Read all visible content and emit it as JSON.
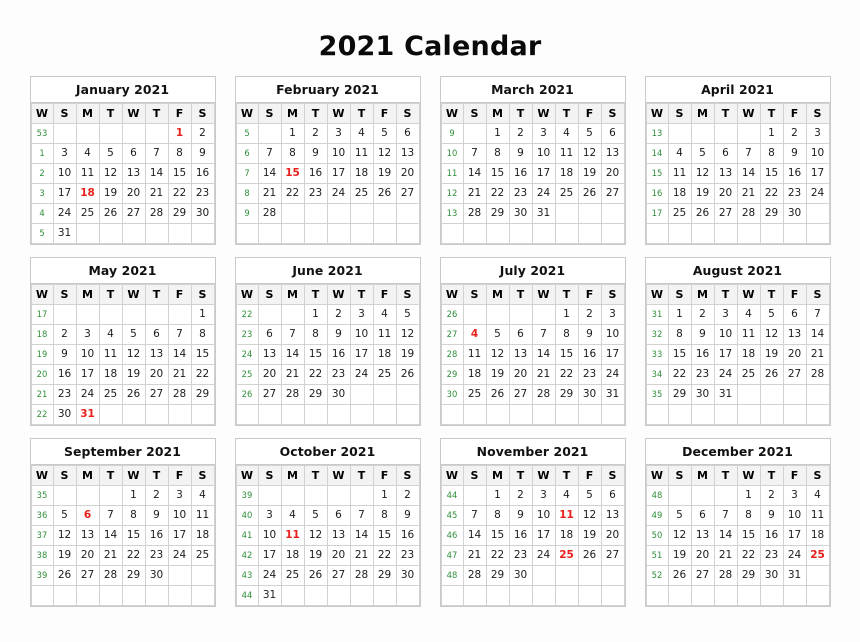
{
  "page": {
    "title": "2021 Calendar",
    "year": "2021"
  },
  "colors": {
    "week_number": "#2f8f3a",
    "holiday": "#e8201c",
    "text": "#1c1c1c",
    "header_bg": "#f3f3f3",
    "border": "#d2d2d2",
    "card_border": "#c9c9c9",
    "page_bg": "#fdfdfd"
  },
  "weekday_headers": [
    "W",
    "S",
    "M",
    "T",
    "W",
    "T",
    "F",
    "S"
  ],
  "months": [
    {
      "name": "January 2021",
      "weeks": [
        {
          "wk": "53",
          "days": [
            "",
            "",
            "",
            "",
            "",
            "1",
            "2"
          ],
          "holidays": [
            "1"
          ]
        },
        {
          "wk": "1",
          "days": [
            "3",
            "4",
            "5",
            "6",
            "7",
            "8",
            "9"
          ],
          "holidays": []
        },
        {
          "wk": "2",
          "days": [
            "10",
            "11",
            "12",
            "13",
            "14",
            "15",
            "16"
          ],
          "holidays": []
        },
        {
          "wk": "3",
          "days": [
            "17",
            "18",
            "19",
            "20",
            "21",
            "22",
            "23"
          ],
          "holidays": [
            "18"
          ]
        },
        {
          "wk": "4",
          "days": [
            "24",
            "25",
            "26",
            "27",
            "28",
            "29",
            "30"
          ],
          "holidays": []
        },
        {
          "wk": "5",
          "days": [
            "31",
            "",
            "",
            "",
            "",
            "",
            ""
          ],
          "holidays": []
        }
      ]
    },
    {
      "name": "February 2021",
      "weeks": [
        {
          "wk": "5",
          "days": [
            "",
            "1",
            "2",
            "3",
            "4",
            "5",
            "6"
          ],
          "holidays": []
        },
        {
          "wk": "6",
          "days": [
            "7",
            "8",
            "9",
            "10",
            "11",
            "12",
            "13"
          ],
          "holidays": []
        },
        {
          "wk": "7",
          "days": [
            "14",
            "15",
            "16",
            "17",
            "18",
            "19",
            "20"
          ],
          "holidays": [
            "15"
          ]
        },
        {
          "wk": "8",
          "days": [
            "21",
            "22",
            "23",
            "24",
            "25",
            "26",
            "27"
          ],
          "holidays": []
        },
        {
          "wk": "9",
          "days": [
            "28",
            "",
            "",
            "",
            "",
            "",
            ""
          ],
          "holidays": []
        },
        {
          "wk": "",
          "days": [
            "",
            "",
            "",
            "",
            "",
            "",
            ""
          ],
          "holidays": []
        }
      ]
    },
    {
      "name": "March 2021",
      "weeks": [
        {
          "wk": "9",
          "days": [
            "",
            "1",
            "2",
            "3",
            "4",
            "5",
            "6"
          ],
          "holidays": []
        },
        {
          "wk": "10",
          "days": [
            "7",
            "8",
            "9",
            "10",
            "11",
            "12",
            "13"
          ],
          "holidays": []
        },
        {
          "wk": "11",
          "days": [
            "14",
            "15",
            "16",
            "17",
            "18",
            "19",
            "20"
          ],
          "holidays": []
        },
        {
          "wk": "12",
          "days": [
            "21",
            "22",
            "23",
            "24",
            "25",
            "26",
            "27"
          ],
          "holidays": []
        },
        {
          "wk": "13",
          "days": [
            "28",
            "29",
            "30",
            "31",
            "",
            "",
            ""
          ],
          "holidays": []
        },
        {
          "wk": "",
          "days": [
            "",
            "",
            "",
            "",
            "",
            "",
            ""
          ],
          "holidays": []
        }
      ]
    },
    {
      "name": "April 2021",
      "weeks": [
        {
          "wk": "13",
          "days": [
            "",
            "",
            "",
            "",
            "1",
            "2",
            "3"
          ],
          "holidays": []
        },
        {
          "wk": "14",
          "days": [
            "4",
            "5",
            "6",
            "7",
            "8",
            "9",
            "10"
          ],
          "holidays": []
        },
        {
          "wk": "15",
          "days": [
            "11",
            "12",
            "13",
            "14",
            "15",
            "16",
            "17"
          ],
          "holidays": []
        },
        {
          "wk": "16",
          "days": [
            "18",
            "19",
            "20",
            "21",
            "22",
            "23",
            "24"
          ],
          "holidays": []
        },
        {
          "wk": "17",
          "days": [
            "25",
            "26",
            "27",
            "28",
            "29",
            "30",
            ""
          ],
          "holidays": []
        },
        {
          "wk": "",
          "days": [
            "",
            "",
            "",
            "",
            "",
            "",
            ""
          ],
          "holidays": []
        }
      ]
    },
    {
      "name": "May 2021",
      "weeks": [
        {
          "wk": "17",
          "days": [
            "",
            "",
            "",
            "",
            "",
            "",
            "1"
          ],
          "holidays": []
        },
        {
          "wk": "18",
          "days": [
            "2",
            "3",
            "4",
            "5",
            "6",
            "7",
            "8"
          ],
          "holidays": []
        },
        {
          "wk": "19",
          "days": [
            "9",
            "10",
            "11",
            "12",
            "13",
            "14",
            "15"
          ],
          "holidays": []
        },
        {
          "wk": "20",
          "days": [
            "16",
            "17",
            "18",
            "19",
            "20",
            "21",
            "22"
          ],
          "holidays": []
        },
        {
          "wk": "21",
          "days": [
            "23",
            "24",
            "25",
            "26",
            "27",
            "28",
            "29"
          ],
          "holidays": []
        },
        {
          "wk": "22",
          "days": [
            "30",
            "31",
            "",
            "",
            "",
            "",
            ""
          ],
          "holidays": [
            "31"
          ]
        }
      ]
    },
    {
      "name": "June 2021",
      "weeks": [
        {
          "wk": "22",
          "days": [
            "",
            "",
            "1",
            "2",
            "3",
            "4",
            "5"
          ],
          "holidays": []
        },
        {
          "wk": "23",
          "days": [
            "6",
            "7",
            "8",
            "9",
            "10",
            "11",
            "12"
          ],
          "holidays": []
        },
        {
          "wk": "24",
          "days": [
            "13",
            "14",
            "15",
            "16",
            "17",
            "18",
            "19"
          ],
          "holidays": []
        },
        {
          "wk": "25",
          "days": [
            "20",
            "21",
            "22",
            "23",
            "24",
            "25",
            "26"
          ],
          "holidays": []
        },
        {
          "wk": "26",
          "days": [
            "27",
            "28",
            "29",
            "30",
            "",
            "",
            ""
          ],
          "holidays": []
        },
        {
          "wk": "",
          "days": [
            "",
            "",
            "",
            "",
            "",
            "",
            ""
          ],
          "holidays": []
        }
      ]
    },
    {
      "name": "July 2021",
      "weeks": [
        {
          "wk": "26",
          "days": [
            "",
            "",
            "",
            "",
            "1",
            "2",
            "3"
          ],
          "holidays": []
        },
        {
          "wk": "27",
          "days": [
            "4",
            "5",
            "6",
            "7",
            "8",
            "9",
            "10"
          ],
          "holidays": [
            "4"
          ]
        },
        {
          "wk": "28",
          "days": [
            "11",
            "12",
            "13",
            "14",
            "15",
            "16",
            "17"
          ],
          "holidays": []
        },
        {
          "wk": "29",
          "days": [
            "18",
            "19",
            "20",
            "21",
            "22",
            "23",
            "24"
          ],
          "holidays": []
        },
        {
          "wk": "30",
          "days": [
            "25",
            "26",
            "27",
            "28",
            "29",
            "30",
            "31"
          ],
          "holidays": []
        },
        {
          "wk": "",
          "days": [
            "",
            "",
            "",
            "",
            "",
            "",
            ""
          ],
          "holidays": []
        }
      ]
    },
    {
      "name": "August 2021",
      "weeks": [
        {
          "wk": "31",
          "days": [
            "1",
            "2",
            "3",
            "4",
            "5",
            "6",
            "7"
          ],
          "holidays": []
        },
        {
          "wk": "32",
          "days": [
            "8",
            "9",
            "10",
            "11",
            "12",
            "13",
            "14"
          ],
          "holidays": []
        },
        {
          "wk": "33",
          "days": [
            "15",
            "16",
            "17",
            "18",
            "19",
            "20",
            "21"
          ],
          "holidays": []
        },
        {
          "wk": "34",
          "days": [
            "22",
            "23",
            "24",
            "25",
            "26",
            "27",
            "28"
          ],
          "holidays": []
        },
        {
          "wk": "35",
          "days": [
            "29",
            "30",
            "31",
            "",
            "",
            "",
            ""
          ],
          "holidays": []
        },
        {
          "wk": "",
          "days": [
            "",
            "",
            "",
            "",
            "",
            "",
            ""
          ],
          "holidays": []
        }
      ]
    },
    {
      "name": "September 2021",
      "weeks": [
        {
          "wk": "35",
          "days": [
            "",
            "",
            "",
            "1",
            "2",
            "3",
            "4"
          ],
          "holidays": []
        },
        {
          "wk": "36",
          "days": [
            "5",
            "6",
            "7",
            "8",
            "9",
            "10",
            "11"
          ],
          "holidays": [
            "6"
          ]
        },
        {
          "wk": "37",
          "days": [
            "12",
            "13",
            "14",
            "15",
            "16",
            "17",
            "18"
          ],
          "holidays": []
        },
        {
          "wk": "38",
          "days": [
            "19",
            "20",
            "21",
            "22",
            "23",
            "24",
            "25"
          ],
          "holidays": []
        },
        {
          "wk": "39",
          "days": [
            "26",
            "27",
            "28",
            "29",
            "30",
            "",
            ""
          ],
          "holidays": []
        },
        {
          "wk": "",
          "days": [
            "",
            "",
            "",
            "",
            "",
            "",
            ""
          ],
          "holidays": []
        }
      ]
    },
    {
      "name": "October 2021",
      "weeks": [
        {
          "wk": "39",
          "days": [
            "",
            "",
            "",
            "",
            "",
            "1",
            "2"
          ],
          "holidays": []
        },
        {
          "wk": "40",
          "days": [
            "3",
            "4",
            "5",
            "6",
            "7",
            "8",
            "9"
          ],
          "holidays": []
        },
        {
          "wk": "41",
          "days": [
            "10",
            "11",
            "12",
            "13",
            "14",
            "15",
            "16"
          ],
          "holidays": [
            "11"
          ]
        },
        {
          "wk": "42",
          "days": [
            "17",
            "18",
            "19",
            "20",
            "21",
            "22",
            "23"
          ],
          "holidays": []
        },
        {
          "wk": "43",
          "days": [
            "24",
            "25",
            "26",
            "27",
            "28",
            "29",
            "30"
          ],
          "holidays": []
        },
        {
          "wk": "44",
          "days": [
            "31",
            "",
            "",
            "",
            "",
            "",
            ""
          ],
          "holidays": []
        }
      ]
    },
    {
      "name": "November 2021",
      "weeks": [
        {
          "wk": "44",
          "days": [
            "",
            "1",
            "2",
            "3",
            "4",
            "5",
            "6"
          ],
          "holidays": []
        },
        {
          "wk": "45",
          "days": [
            "7",
            "8",
            "9",
            "10",
            "11",
            "12",
            "13"
          ],
          "holidays": [
            "11"
          ]
        },
        {
          "wk": "46",
          "days": [
            "14",
            "15",
            "16",
            "17",
            "18",
            "19",
            "20"
          ],
          "holidays": []
        },
        {
          "wk": "47",
          "days": [
            "21",
            "22",
            "23",
            "24",
            "25",
            "26",
            "27"
          ],
          "holidays": [
            "25"
          ]
        },
        {
          "wk": "48",
          "days": [
            "28",
            "29",
            "30",
            "",
            "",
            "",
            ""
          ],
          "holidays": []
        },
        {
          "wk": "",
          "days": [
            "",
            "",
            "",
            "",
            "",
            "",
            ""
          ],
          "holidays": []
        }
      ]
    },
    {
      "name": "December 2021",
      "weeks": [
        {
          "wk": "48",
          "days": [
            "",
            "",
            "",
            "1",
            "2",
            "3",
            "4"
          ],
          "holidays": []
        },
        {
          "wk": "49",
          "days": [
            "5",
            "6",
            "7",
            "8",
            "9",
            "10",
            "11"
          ],
          "holidays": []
        },
        {
          "wk": "50",
          "days": [
            "12",
            "13",
            "14",
            "15",
            "16",
            "17",
            "18"
          ],
          "holidays": []
        },
        {
          "wk": "51",
          "days": [
            "19",
            "20",
            "21",
            "22",
            "23",
            "24",
            "25"
          ],
          "holidays": [
            "25"
          ]
        },
        {
          "wk": "52",
          "days": [
            "26",
            "27",
            "28",
            "29",
            "30",
            "31",
            ""
          ],
          "holidays": []
        },
        {
          "wk": "",
          "days": [
            "",
            "",
            "",
            "",
            "",
            "",
            ""
          ],
          "holidays": []
        }
      ]
    }
  ]
}
